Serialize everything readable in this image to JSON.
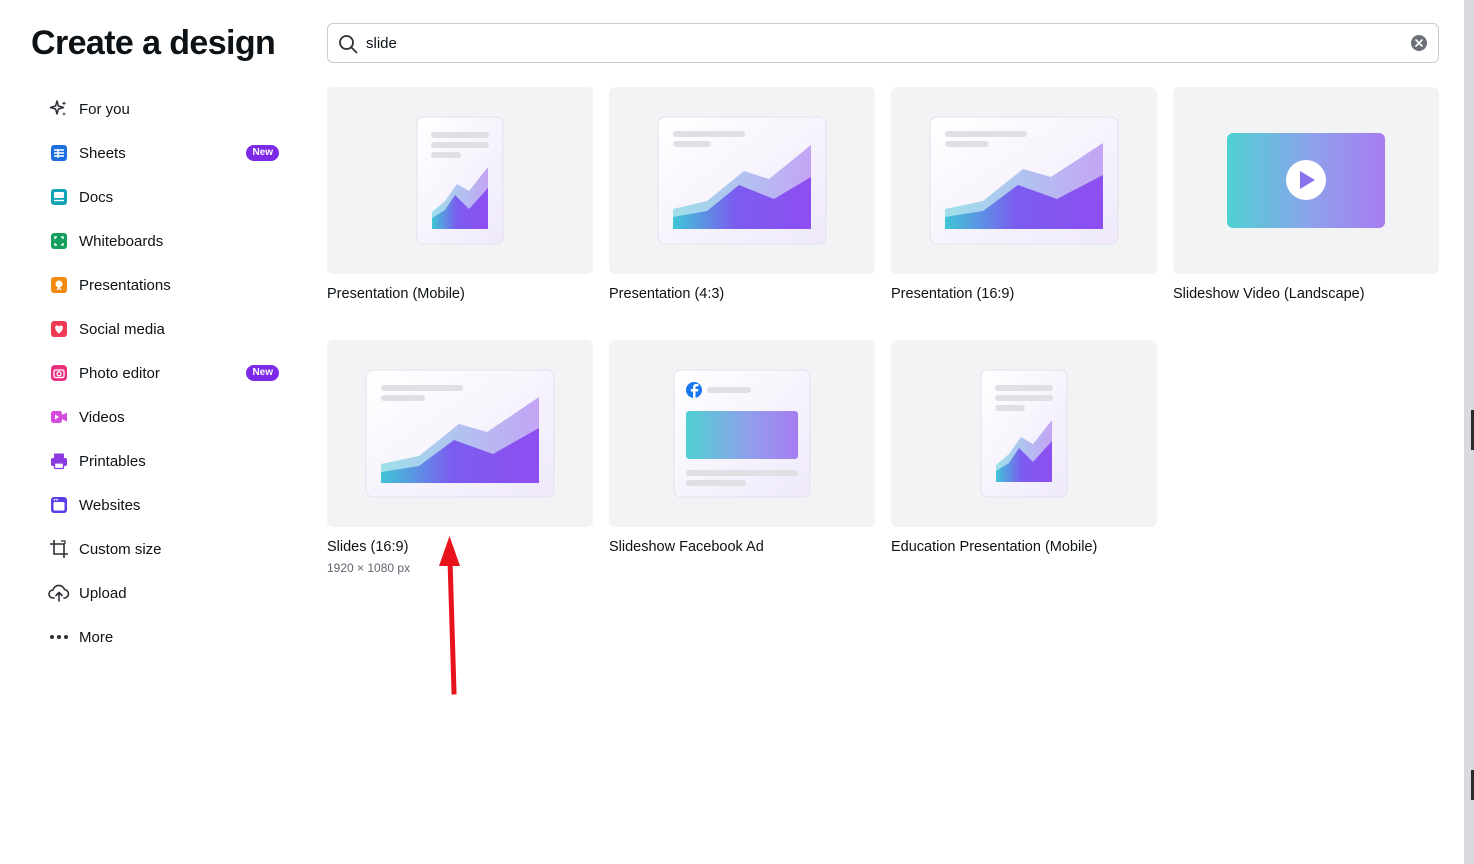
{
  "title": "Create a design",
  "search": {
    "value": "slide",
    "placeholder": ""
  },
  "nav": [
    {
      "label": "For you",
      "icon": "sparkle-icon"
    },
    {
      "label": "Sheets",
      "icon": "sheets-icon",
      "badge": "New"
    },
    {
      "label": "Docs",
      "icon": "docs-icon"
    },
    {
      "label": "Whiteboards",
      "icon": "whiteboard-icon"
    },
    {
      "label": "Presentations",
      "icon": "presentation-icon"
    },
    {
      "label": "Social media",
      "icon": "heart-icon"
    },
    {
      "label": "Photo editor",
      "icon": "camera-icon",
      "badge": "New"
    },
    {
      "label": "Videos",
      "icon": "video-icon"
    },
    {
      "label": "Printables",
      "icon": "printer-icon"
    },
    {
      "label": "Websites",
      "icon": "website-icon"
    },
    {
      "label": "Custom size",
      "icon": "crop-icon"
    },
    {
      "label": "Upload",
      "icon": "cloud-upload-icon"
    },
    {
      "label": "More",
      "icon": "more-icon"
    }
  ],
  "results": [
    {
      "label": "Presentation (Mobile)"
    },
    {
      "label": "Presentation (4:3)"
    },
    {
      "label": "Presentation (16:9)"
    },
    {
      "label": "Slideshow Video (Landscape)"
    },
    {
      "label": "Slides (16:9)",
      "sub": "1920 × 1080 px"
    },
    {
      "label": "Slideshow Facebook Ad"
    },
    {
      "label": "Education Presentation (Mobile)"
    }
  ],
  "colors": {
    "accent": "#7d2ae8",
    "arrow": "#e8141b",
    "thumb_bg": "#f2f3f5"
  }
}
